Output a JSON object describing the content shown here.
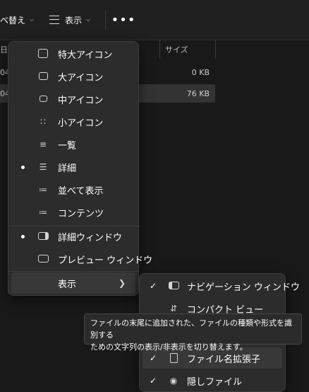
{
  "toolbar": {
    "sort_label": "ベ替え",
    "view_label": "表示",
    "more_label": "•••"
  },
  "file_list": {
    "columns": {
      "size": "サイズ"
    },
    "rows": [
      {
        "date": "04",
        "size": "0 KB"
      },
      {
        "date": "04",
        "size": "76 KB"
      }
    ],
    "partial_header": "日"
  },
  "view_menu": {
    "items": [
      {
        "label": "特大アイコン",
        "icon": "extra-large-icons-icon",
        "selected": false
      },
      {
        "label": "大アイコン",
        "icon": "large-icons-icon",
        "selected": false
      },
      {
        "label": "中アイコン",
        "icon": "medium-icons-icon",
        "selected": false
      },
      {
        "label": "小アイコン",
        "icon": "small-icons-icon",
        "selected": false
      },
      {
        "label": "一覧",
        "icon": "list-icon",
        "selected": false
      },
      {
        "label": "詳細",
        "icon": "details-icon",
        "selected": true
      },
      {
        "label": "並べて表示",
        "icon": "tiles-icon",
        "selected": false
      },
      {
        "label": "コンテンツ",
        "icon": "content-icon",
        "selected": false
      }
    ],
    "panes": [
      {
        "label": "詳細ウィンドウ",
        "icon": "details-pane-icon",
        "selected": true
      },
      {
        "label": "プレビュー ウィンドウ",
        "icon": "preview-pane-icon",
        "selected": false
      }
    ],
    "show": {
      "label": "表示",
      "icon": "chevron-right-icon"
    }
  },
  "show_submenu": {
    "items": [
      {
        "label": "ナビゲーション ウィンドウ",
        "icon": "navigation-pane-icon",
        "checked": true
      },
      {
        "label": "コンパクト ビュー",
        "icon": "compact-view-icon",
        "checked": false
      },
      {
        "label": "ファイル名拡張子",
        "icon": "file-extension-icon",
        "checked": true
      },
      {
        "label": "隠しファイル",
        "icon": "hidden-files-icon",
        "checked": true
      }
    ]
  },
  "tooltip": {
    "text_line1": "ファイルの末尾に追加された、ファイルの種類や形式を識別する",
    "text_line2": "ための文字列の表示/非表示を切り替えます。"
  }
}
